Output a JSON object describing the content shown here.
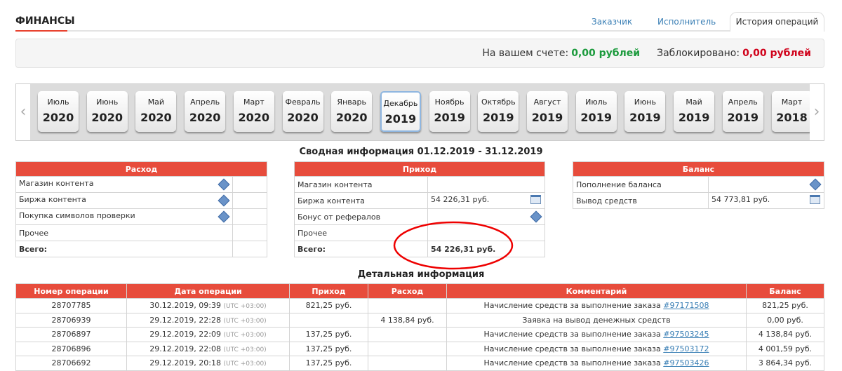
{
  "header": {
    "title": "ФИНАНСЫ",
    "tabs": [
      {
        "label": "Заказчик"
      },
      {
        "label": "Исполнитель"
      },
      {
        "label": "История операций"
      }
    ]
  },
  "balance": {
    "account_label": "На вашем счете:",
    "account_value": "0,00 рублей",
    "blocked_label": "Заблокировано:",
    "blocked_value": "0,00 рублей"
  },
  "months": [
    {
      "m": "Июль",
      "y": "2020"
    },
    {
      "m": "Июнь",
      "y": "2020"
    },
    {
      "m": "Май",
      "y": "2020"
    },
    {
      "m": "Апрель",
      "y": "2020"
    },
    {
      "m": "Март",
      "y": "2020"
    },
    {
      "m": "Февраль",
      "y": "2020"
    },
    {
      "m": "Январь",
      "y": "2020"
    },
    {
      "m": "Декабрь",
      "y": "2019"
    },
    {
      "m": "Ноябрь",
      "y": "2019"
    },
    {
      "m": "Октябрь",
      "y": "2019"
    },
    {
      "m": "Август",
      "y": "2019"
    },
    {
      "m": "Июль",
      "y": "2019"
    },
    {
      "m": "Июнь",
      "y": "2019"
    },
    {
      "m": "Май",
      "y": "2019"
    },
    {
      "m": "Апрель",
      "y": "2019"
    },
    {
      "m": "Март",
      "y": "2018"
    }
  ],
  "selected_month_index": 7,
  "summary": {
    "title": "Сводная информация 01.12.2019 - 31.12.2019",
    "expense": {
      "header": "Расход",
      "rows": [
        {
          "label": "Магазин контента",
          "value": ""
        },
        {
          "label": "Биржа контента",
          "value": ""
        },
        {
          "label": "Покупка символов проверки",
          "value": ""
        },
        {
          "label": "Прочее",
          "value": ""
        },
        {
          "label": "Всего:",
          "value": ""
        }
      ]
    },
    "income": {
      "header": "Приход",
      "rows": [
        {
          "label": "Магазин контента",
          "value": ""
        },
        {
          "label": "Биржа контента",
          "value": "54 226,31 руб."
        },
        {
          "label": "Бонус от рефералов",
          "value": ""
        },
        {
          "label": "Прочее",
          "value": ""
        },
        {
          "label": "Всего:",
          "value": "54 226,31 руб."
        }
      ]
    },
    "balance": {
      "header": "Баланс",
      "rows": [
        {
          "label": "Пополнение баланса",
          "value": ""
        },
        {
          "label": "Вывод средств",
          "value": "54 773,81 руб."
        }
      ]
    }
  },
  "detail": {
    "title": "Детальная информация",
    "columns": [
      "Номер операции",
      "Дата операции",
      "Приход",
      "Расход",
      "Комментарий",
      "Баланс"
    ],
    "rows": [
      {
        "id": "28707785",
        "date": "30.12.2019, 09:39",
        "tz": "(UTC +03:00)",
        "in": "821,25 руб.",
        "out": "",
        "comment": "Начисление средств за выполнение заказа",
        "link": "#97171508",
        "balance": "821,25 руб."
      },
      {
        "id": "28706939",
        "date": "29.12.2019, 22:28",
        "tz": "(UTC +03:00)",
        "in": "",
        "out": "4 138,84 руб.",
        "comment": "Заявка на вывод денежных средств",
        "link": "",
        "balance": "0,00 руб."
      },
      {
        "id": "28706897",
        "date": "29.12.2019, 22:09",
        "tz": "(UTC +03:00)",
        "in": "137,25 руб.",
        "out": "",
        "comment": "Начисление средств за выполнение заказа",
        "link": "#97503245",
        "balance": "4 138,84 руб."
      },
      {
        "id": "28706896",
        "date": "29.12.2019, 22:08",
        "tz": "(UTC +03:00)",
        "in": "137,25 руб.",
        "out": "",
        "comment": "Начисление средств за выполнение заказа",
        "link": "#97503172",
        "balance": "4 001,59 руб."
      },
      {
        "id": "28706692",
        "date": "29.12.2019, 20:18",
        "tz": "(UTC +03:00)",
        "in": "137,25 руб.",
        "out": "",
        "comment": "Начисление средств за выполнение заказа",
        "link": "#97503426",
        "balance": "3 864,34 руб."
      }
    ]
  }
}
